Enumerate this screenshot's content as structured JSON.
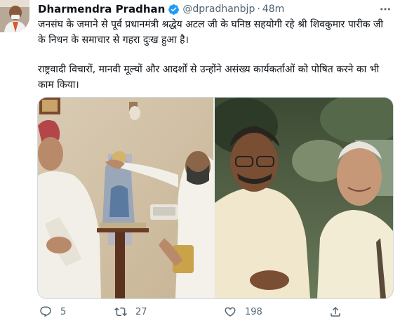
{
  "tweet": {
    "author_name": "Dharmendra Pradhan",
    "handle": "@dpradhanbjp",
    "separator": "·",
    "time": "48m",
    "paragraphs": [
      "जनसंघ के जमाने से पूर्व प्रधानमंत्री श्रद्धेय अटल जी के घनिष्ठ सहयोगी रहे श्री शिवकुमार पारीक जी के निधन के समाचार से गहरा दुःख हुआ है।",
      "राष्ट्रवादी विचारों, मानवी मूल्यों और आदर्शों से उन्होंने असंख्य कार्यकर्ताओं को पोषित करने का भी काम किया।"
    ],
    "actions": {
      "replies": "5",
      "retweets": "27",
      "likes": "198"
    }
  },
  "icons": {
    "verified": "verified-badge-icon",
    "more": "more-icon",
    "reply": "reply-icon",
    "retweet": "retweet-icon",
    "like": "heart-icon",
    "share": "share-icon"
  },
  "colors": {
    "text": "#0f1419",
    "secondary": "#536471",
    "verified": "#1d9bf0",
    "border": "#cfd9de"
  }
}
